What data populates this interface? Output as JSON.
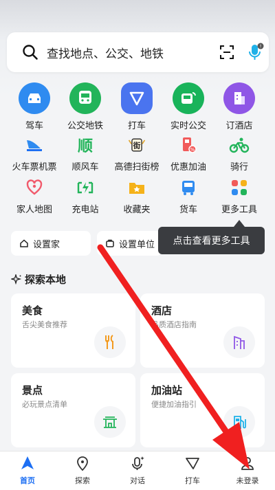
{
  "search": {
    "placeholder": "查找地点、公交、地铁"
  },
  "grid_row1": [
    {
      "label": "驾车",
      "color": "#2f8bf0"
    },
    {
      "label": "公交地铁",
      "color": "#22b45a"
    },
    {
      "label": "打车",
      "color": "#4a74ef"
    },
    {
      "label": "实时公交",
      "color": "#19b35a"
    },
    {
      "label": "订酒店",
      "color": "#8f56e6"
    }
  ],
  "grid_row2": [
    {
      "label": "火车票机票"
    },
    {
      "label": "顺风车",
      "icon_text": "顺"
    },
    {
      "label": "高德扫街榜",
      "icon_text": "街"
    },
    {
      "label": "优惠加油"
    },
    {
      "label": "骑行"
    }
  ],
  "grid_row3": [
    {
      "label": "家人地图"
    },
    {
      "label": "充电站"
    },
    {
      "label": "收藏夹"
    },
    {
      "label": "货车"
    },
    {
      "label": "更多工具"
    }
  ],
  "set_home": "设置家",
  "set_work": "设置单位",
  "tooltip": "点击查看更多工具",
  "explore_title": "探索本地",
  "cards": [
    {
      "title": "美食",
      "subtitle": "舌尖美食推荐"
    },
    {
      "title": "酒店",
      "subtitle": "品质酒店指南"
    },
    {
      "title": "景点",
      "subtitle": "必玩景点清单"
    },
    {
      "title": "加油站",
      "subtitle": "便捷加油指引"
    }
  ],
  "tabs": [
    {
      "label": "首页"
    },
    {
      "label": "探索"
    },
    {
      "label": "对话"
    },
    {
      "label": "打车"
    },
    {
      "label": "未登录"
    }
  ],
  "colors": {
    "accent": "#1d6ff3",
    "arrow": "#f02020"
  }
}
